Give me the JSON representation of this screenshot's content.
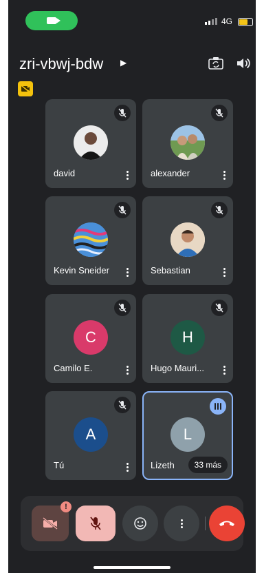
{
  "status_bar": {
    "network": "4G",
    "battery_color": "#f5c518",
    "pill_color": "#30c15a"
  },
  "header": {
    "meeting_code": "zri-vbwj-bdw",
    "icons": [
      "switch-camera-icon",
      "speaker-icon"
    ]
  },
  "participants": [
    {
      "name": "david",
      "avatar_type": "photo",
      "muted": true
    },
    {
      "name": "alexander",
      "avatar_type": "photo",
      "muted": true
    },
    {
      "name": "Kevin Sneider",
      "avatar_type": "photo",
      "muted": true
    },
    {
      "name": "Sebastian",
      "avatar_type": "photo",
      "muted": true
    },
    {
      "name": "Camilo E.",
      "initial": "C",
      "avatar_color": "#d93a6a",
      "muted": true
    },
    {
      "name": "Hugo Mauri...",
      "initial": "H",
      "avatar_color": "#1e5945",
      "muted": true
    },
    {
      "name": "Tú",
      "initial": "A",
      "avatar_color": "#1b4e8c",
      "muted": true
    },
    {
      "name": "Lizeth",
      "initial": "L",
      "avatar_color": "#8fa1ab",
      "speaking": true,
      "more_label": "33 más"
    }
  ],
  "controls": {
    "camera_alert": "!",
    "items": [
      "camera-off-icon",
      "mic-off-icon",
      "emoji-icon",
      "more-options-icon",
      "end-call-icon"
    ]
  }
}
